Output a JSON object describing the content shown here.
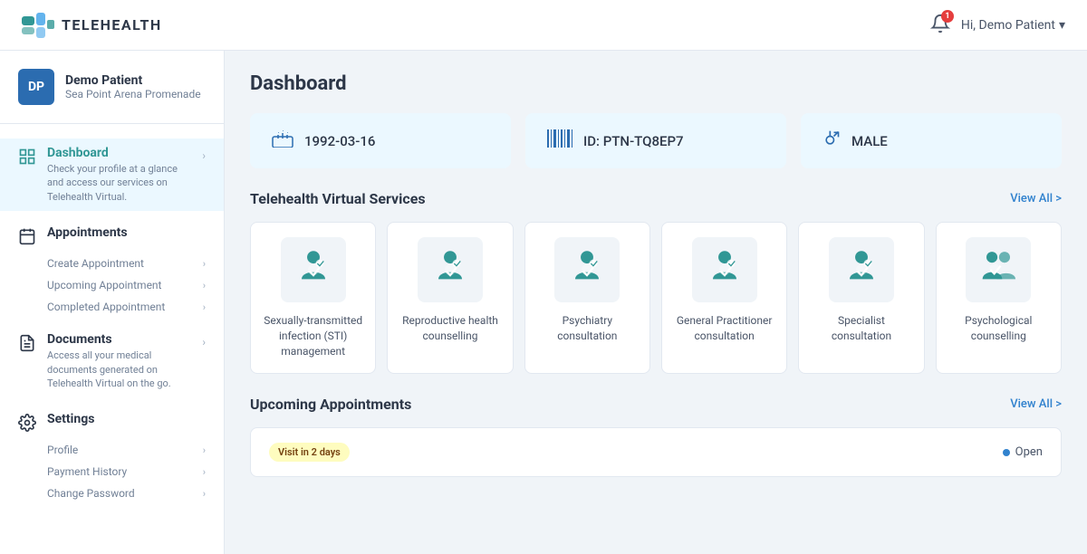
{
  "header": {
    "logo_text": "TELEHEALTH",
    "notification_count": "1",
    "user_greeting": "Hi, Demo Patient"
  },
  "sidebar": {
    "user": {
      "initials": "DP",
      "name": "Demo Patient",
      "location": "Sea Point Arena Promenade"
    },
    "nav": [
      {
        "id": "dashboard",
        "label": "Dashboard",
        "description": "Check your profile at a glance and access our services on Telehealth Virtual.",
        "active": true,
        "sub_items": []
      },
      {
        "id": "appointments",
        "label": "Appointments",
        "description": "",
        "active": false,
        "sub_items": [
          "Create Appointment",
          "Upcoming Appointment",
          "Completed Appointment"
        ]
      },
      {
        "id": "documents",
        "label": "Documents",
        "description": "Access all your medical documents generated on Telehealth Virtual on the go.",
        "active": false,
        "sub_items": []
      },
      {
        "id": "settings",
        "label": "Settings",
        "description": "",
        "active": false,
        "sub_items": [
          "Profile",
          "Payment History",
          "Change Password"
        ]
      }
    ]
  },
  "main": {
    "page_title": "Dashboard",
    "stats": [
      {
        "icon": "🎂",
        "value": "1992-03-16"
      },
      {
        "icon": "|||",
        "value": "ID: PTN-TQ8EP7"
      },
      {
        "icon": "♂",
        "value": "MALE"
      }
    ],
    "services_section": {
      "title": "Telehealth Virtual Services",
      "view_all": "View All >",
      "items": [
        {
          "label": "Sexually-transmitted infection (STI) management"
        },
        {
          "label": "Reproductive health counselling"
        },
        {
          "label": "Psychiatry consultation"
        },
        {
          "label": "General Practitioner consultation"
        },
        {
          "label": "Specialist consultation"
        },
        {
          "label": "Psychological counselling"
        }
      ]
    },
    "appointments_section": {
      "title": "Upcoming Appointments",
      "view_all": "View All >",
      "items": [
        {
          "badge": "Visit in 2 days",
          "status": "Open"
        }
      ]
    }
  }
}
